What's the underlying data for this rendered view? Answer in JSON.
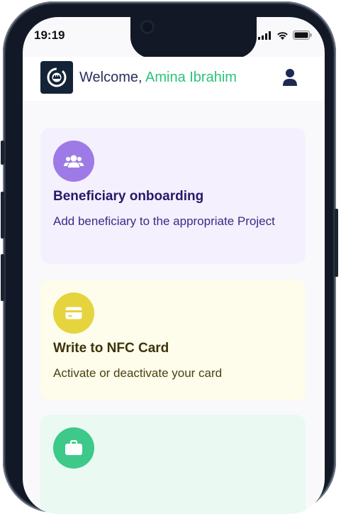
{
  "status_bar": {
    "time": "19:19"
  },
  "header": {
    "welcome_text": "Welcome,",
    "user_name": "Amina Ibrahim"
  },
  "cards": [
    {
      "title": "Beneficiary onboarding",
      "description": "Add beneficiary to the appropriate Project",
      "icon": "users-icon",
      "accent_color": "#9d7ae6"
    },
    {
      "title": "Write to NFC Card",
      "description": "Activate or deactivate your card",
      "icon": "card-icon",
      "accent_color": "#e5d43e"
    },
    {
      "title": "",
      "description": "",
      "icon": "briefcase-icon",
      "accent_color": "#3cc98a"
    }
  ],
  "colors": {
    "brand_dark": "#152337",
    "name_green": "#2cc37a",
    "text_navy": "#2a2f5c"
  }
}
